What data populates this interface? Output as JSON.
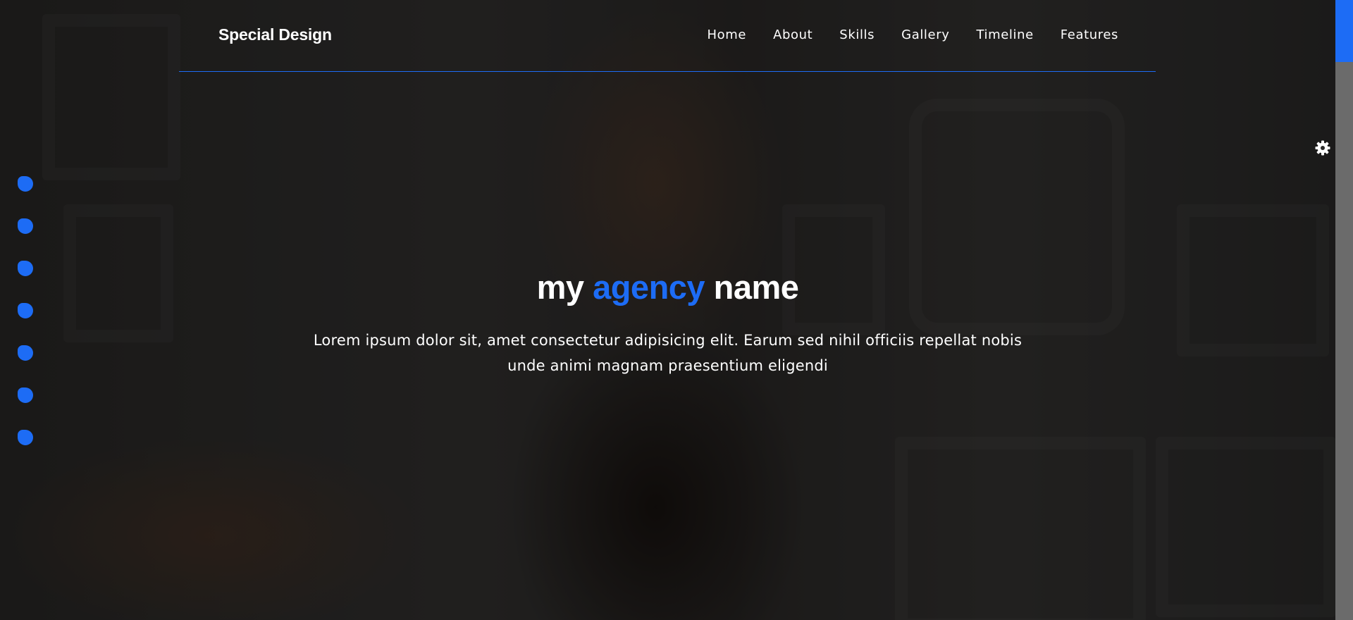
{
  "header": {
    "logo": "Special Design",
    "nav": [
      "Home",
      "About",
      "Skills",
      "Gallery",
      "Timeline",
      "Features"
    ]
  },
  "hero": {
    "title_part1": "my ",
    "title_accent": "agency",
    "title_part2": " name",
    "description": "Lorem ipsum dolor sit, amet consectetur adipisicing elit. Earum sed nihil officiis repellat nobis unde animi magnam praesentium eligendi"
  },
  "bullets_count": 7,
  "icons": {
    "settings": "gear-icon"
  },
  "colors": {
    "accent": "#1d6cf5",
    "text": "#ffffff"
  }
}
